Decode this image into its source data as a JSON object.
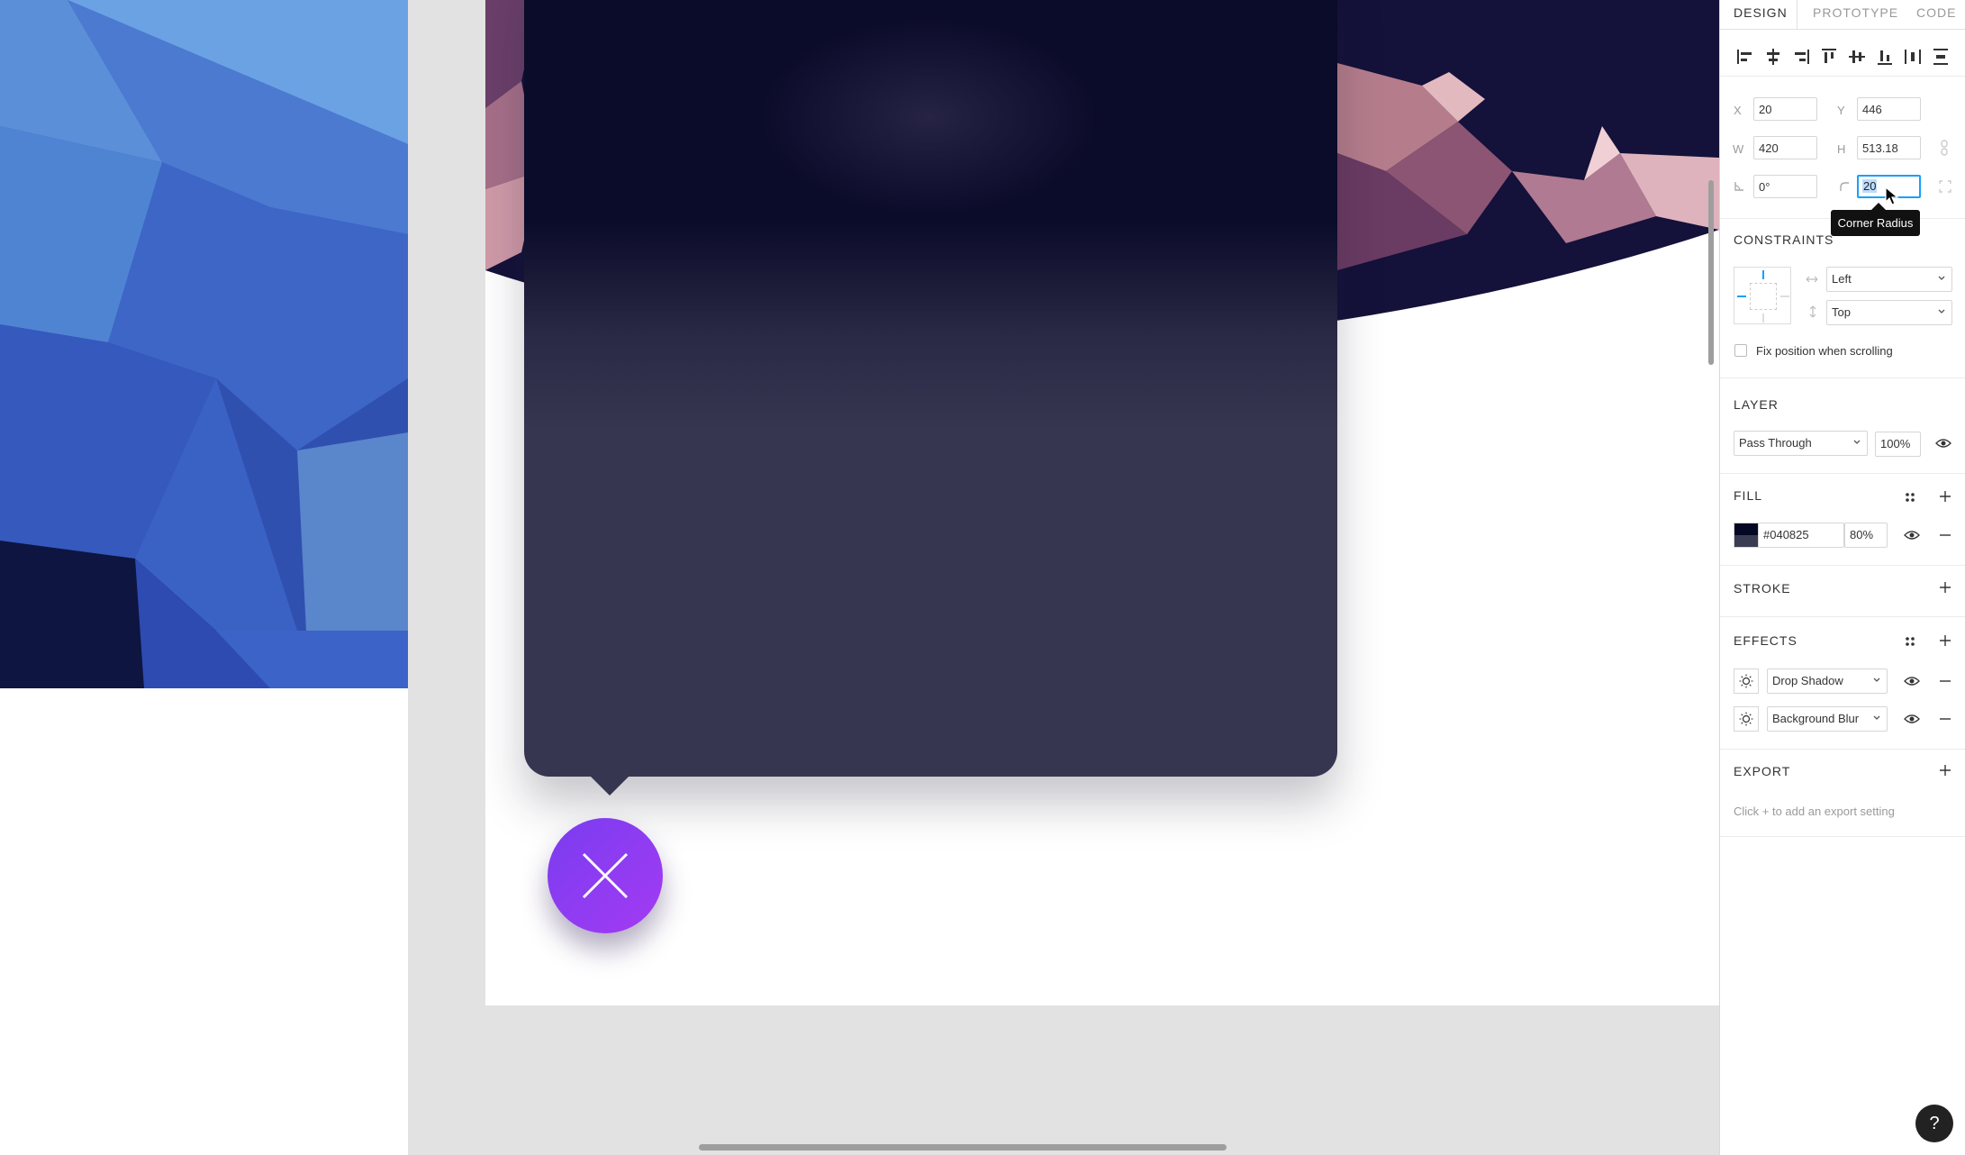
{
  "panel": {
    "tabs": [
      "DESIGN",
      "PROTOTYPE",
      "CODE"
    ],
    "active_tab": "DESIGN",
    "position": {
      "x_label": "X",
      "x_value": "20",
      "y_label": "Y",
      "y_value": "446",
      "w_label": "W",
      "w_value": "420",
      "h_label": "H",
      "h_value": "513.18",
      "rotation_value": "0°",
      "radius_value": "20"
    },
    "tooltip": "Corner Radius",
    "constraints": {
      "title": "CONSTRAINTS",
      "horizontal": "Left",
      "vertical": "Top",
      "fix_position_label": "Fix position when scrolling",
      "fix_position_checked": false
    },
    "layer": {
      "title": "LAYER",
      "blend_mode": "Pass Through",
      "opacity": "100%"
    },
    "fill": {
      "title": "FILL",
      "hex": "#040825",
      "opacity": "80%",
      "swatch_color": "#040825"
    },
    "stroke": {
      "title": "STROKE"
    },
    "effects": {
      "title": "EFFECTS",
      "items": [
        "Drop Shadow",
        "Background Blur"
      ]
    },
    "export": {
      "title": "EXPORT",
      "hint": "Click + to add an export setting"
    },
    "help_label": "?"
  },
  "colors": {
    "accent": "#18a0fb",
    "fab_start": "#7a3cf0",
    "fab_end": "#a33bf3",
    "card": "#373651"
  },
  "icons": {
    "fab": "close-icon",
    "help": "help-icon"
  }
}
